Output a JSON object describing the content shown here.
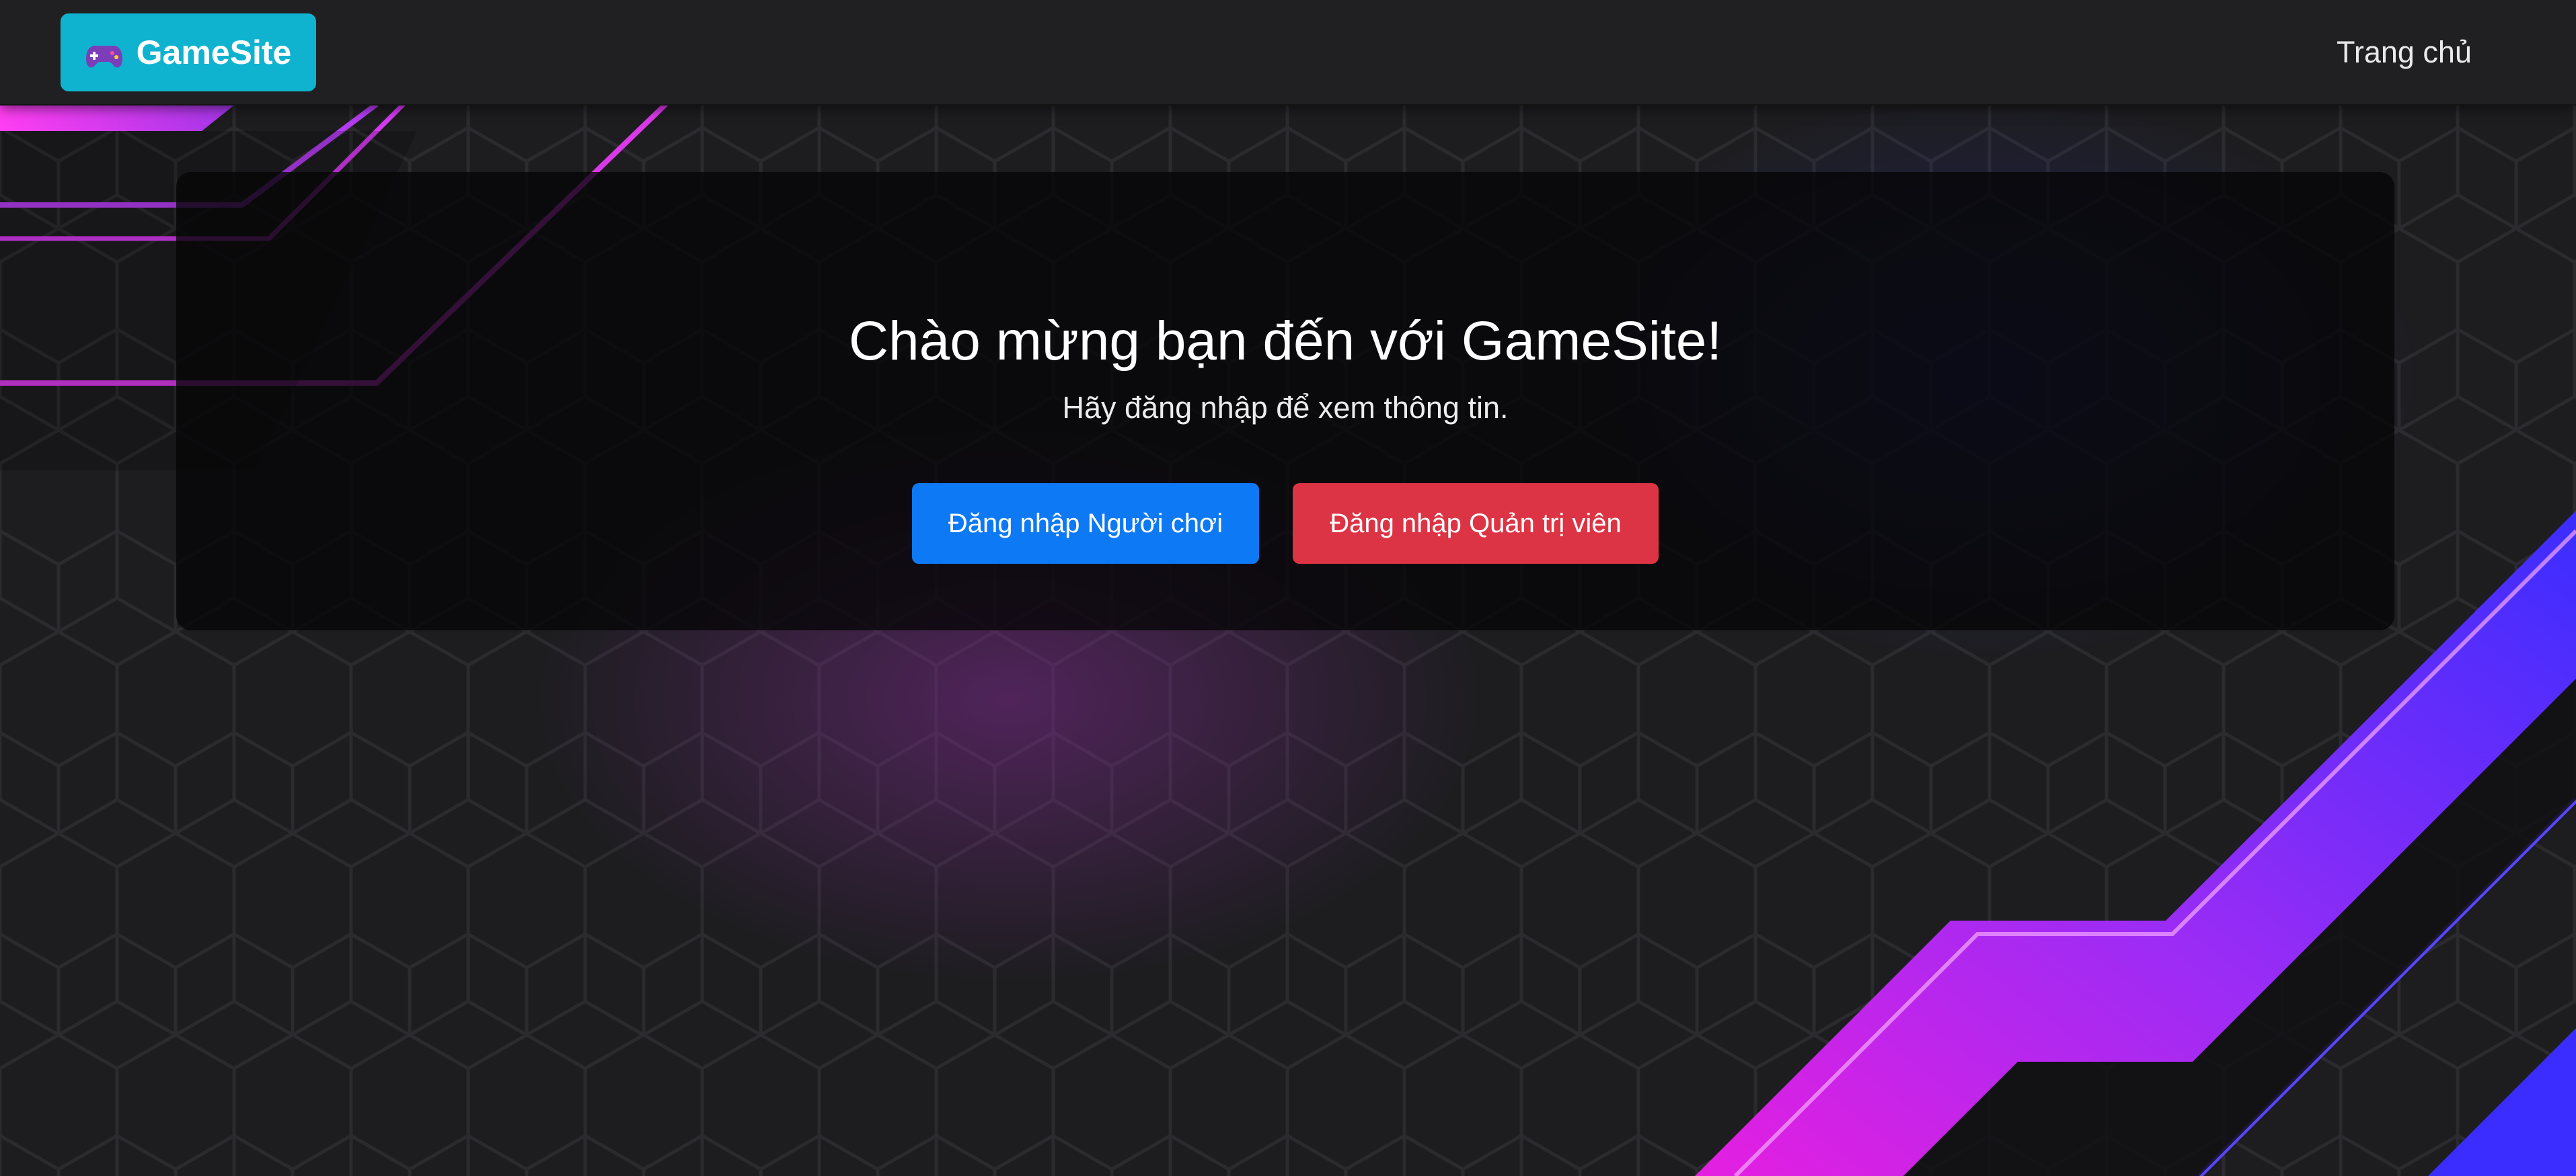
{
  "navbar": {
    "brand_label": "GameSite",
    "brand_icon": "gamepad-icon",
    "home_link": "Trang chủ"
  },
  "welcome": {
    "title": "Chào mừng bạn đến với GameSite!",
    "subtitle": "Hãy đăng nhập để xem thông tin.",
    "player_login_label": "Đăng nhập Người chơi",
    "admin_login_label": "Đăng nhập Quản trị viên"
  },
  "colors": {
    "brand_bg": "#0fb3cf",
    "navbar_bg": "#202022",
    "player_button": "#0d79f5",
    "admin_button": "#dc3444",
    "accent_magenta": "#e11ee8",
    "accent_blue": "#3c2cff"
  }
}
